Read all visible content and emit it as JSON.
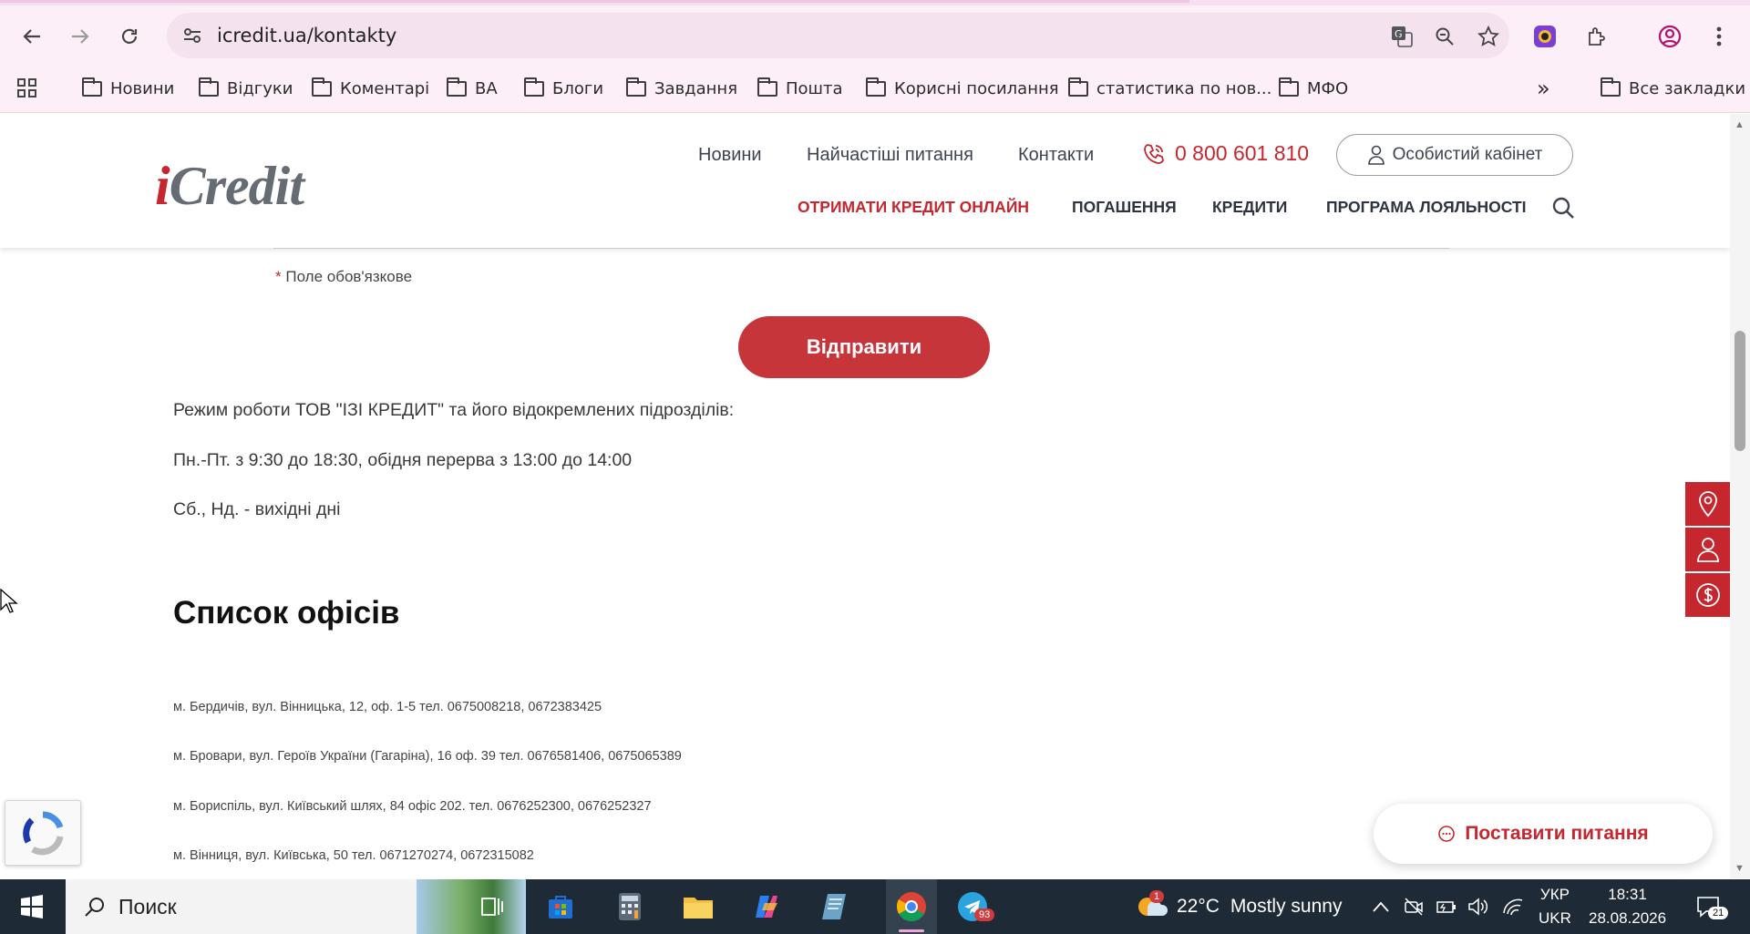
{
  "browser": {
    "url": "icredit.ua/kontakty",
    "bookmarks": [
      "Новини",
      "Відгуки",
      "Коментарі",
      "ВА",
      "Блоги",
      "Завдання",
      "Пошта",
      "Корисні посилання",
      "статистика по нов...",
      "МФО"
    ],
    "all_bookmarks": "Все закладки",
    "more": "»"
  },
  "site": {
    "logo_i": "i",
    "logo_rest": "Credit",
    "topnav": [
      "Новини",
      "Найчастіші питання",
      "Контакти"
    ],
    "phone": "0 800 601 810",
    "cabinet": "Особистий кабінет",
    "mainnav": [
      "ОТРИМАТИ КРЕДИТ ОНЛАЙН",
      "ПОГАШЕННЯ",
      "КРЕДИТИ",
      "ПРОГРАМА ЛОЯЛЬНОСТІ"
    ]
  },
  "form": {
    "required_star": "*",
    "required_note": "Поле обов'язкове",
    "submit": "Відправити"
  },
  "schedule": [
    "Режим роботи ТОВ \"ІЗІ КРЕДИТ\" та його відокремлених підрозділів:",
    "Пн.-Пт. з 9:30 до 18:30, обідня перерва з 13:00 до 14:00",
    "Сб., Нд. - вихідні дні"
  ],
  "offices_title": "Список офісів",
  "offices": [
    "м. Бердичів, вул. Вінницька, 12, оф. 1-5 тел. 0675008218, 0672383425",
    "м. Бровари, вул. Героїв України (Гагаріна), 16 оф. 39 тел. 0676581406, 0675065389",
    "м. Бориспіль, вул. Київський шлях, 84 офіс 202. тел. 0676252300, 0676252327",
    "м. Вінниця, вул. Київська, 50 тел. 0671270274, 0672315082"
  ],
  "ask_button": "Поставити питання",
  "taskbar": {
    "search": "Поиск",
    "telegram_badge": "93",
    "weather_badge": "1",
    "temperature": "22°C",
    "weather": "Mostly sunny",
    "lang_top": "УКР",
    "lang_bottom": "UKR",
    "time": "18:31",
    "date": "28.08.2026",
    "notifications": "21"
  },
  "colors": {
    "brand_red": "#c6262e",
    "logo_gray": "#666c73",
    "chrome_bg": "#fdeff8"
  }
}
